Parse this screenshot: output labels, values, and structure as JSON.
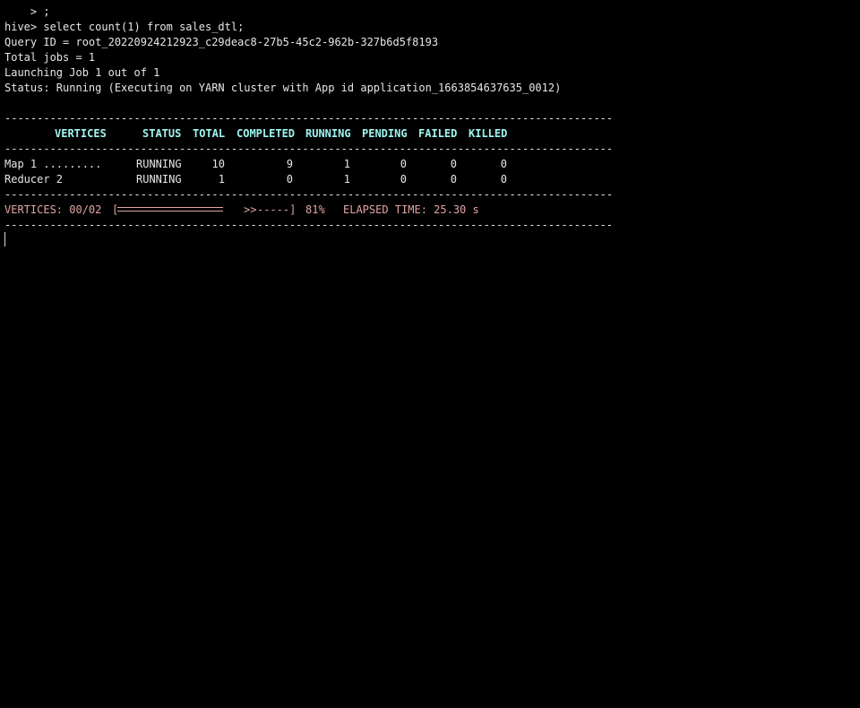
{
  "terminal": {
    "lines": {
      "l0": "    > ;",
      "l1": "hive> select count(1) from sales_dtl;",
      "l2": "Query ID = root_20220924212923_c29deac8-27b5-45c2-962b-327b6d5f8193",
      "l3": "Total jobs = 1",
      "l4": "Launching Job 1 out of 1",
      "l5": "Status: Running (Executing on YARN cluster with App id application_1663854637635_0012)"
    },
    "separator": "----------------------------------------------------------------------------------------------",
    "table": {
      "headers": [
        "VERTICES",
        "STATUS",
        "TOTAL",
        "COMPLETED",
        "RUNNING",
        "PENDING",
        "FAILED",
        "KILLED"
      ],
      "rows": [
        {
          "vertex": "Map 1 .........",
          "status": "RUNNING",
          "total": "10",
          "completed": "9",
          "running": "1",
          "pending": "0",
          "failed": "0",
          "killed": "0"
        },
        {
          "vertex": "Reducer 2",
          "status": "RUNNING",
          "total": "1",
          "completed": "0",
          "running": "1",
          "pending": "0",
          "failed": "0",
          "killed": "0"
        }
      ]
    },
    "progress": {
      "vertices_label": "VERTICES: 00/02",
      "bar_open": "[",
      "bar_arrows": ">>",
      "bar_rest": "-----]",
      "percent_text": "81%",
      "percent": 0.81,
      "elapsed": "ELAPSED TIME: 25.30 s"
    }
  },
  "colors": {
    "background": "#000000",
    "text": "#e6e6e6",
    "header": "#9ff5f0",
    "progress": "#e2a4a4"
  }
}
